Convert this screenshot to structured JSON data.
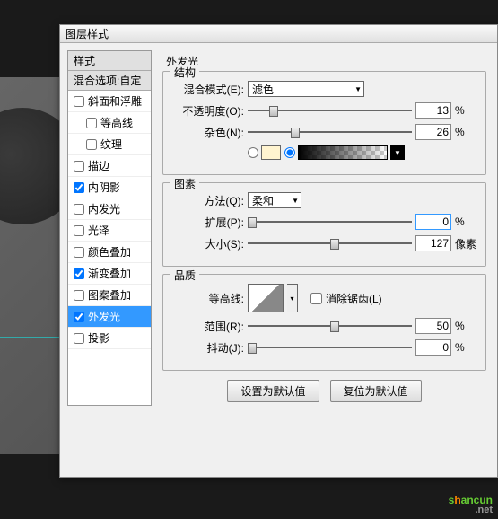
{
  "dialog": {
    "title": "图层样式"
  },
  "sidebar": {
    "header": "样式",
    "blend_header": "混合选项:自定",
    "items": [
      {
        "label": "斜面和浮雕",
        "checked": false,
        "indent": false
      },
      {
        "label": "等高线",
        "checked": false,
        "indent": true
      },
      {
        "label": "纹理",
        "checked": false,
        "indent": true
      },
      {
        "label": "描边",
        "checked": false,
        "indent": false
      },
      {
        "label": "内阴影",
        "checked": true,
        "indent": false
      },
      {
        "label": "内发光",
        "checked": false,
        "indent": false
      },
      {
        "label": "光泽",
        "checked": false,
        "indent": false
      },
      {
        "label": "颜色叠加",
        "checked": false,
        "indent": false
      },
      {
        "label": "渐变叠加",
        "checked": true,
        "indent": false
      },
      {
        "label": "图案叠加",
        "checked": false,
        "indent": false
      },
      {
        "label": "外发光",
        "checked": true,
        "indent": false,
        "selected": true
      },
      {
        "label": "投影",
        "checked": false,
        "indent": false
      }
    ]
  },
  "panel": {
    "title": "外发光",
    "struct": {
      "label": "结构",
      "blend_mode_label": "混合模式(E):",
      "blend_mode_value": "滤色",
      "opacity_label": "不透明度(O):",
      "opacity_value": "13",
      "opacity_unit": "%",
      "noise_label": "杂色(N):",
      "noise_value": "26",
      "noise_unit": "%"
    },
    "element": {
      "label": "图素",
      "method_label": "方法(Q):",
      "method_value": "柔和",
      "spread_label": "扩展(P):",
      "spread_value": "0",
      "spread_unit": "%",
      "size_label": "大小(S):",
      "size_value": "127",
      "size_unit": "像素"
    },
    "quality": {
      "label": "品质",
      "contour_label": "等高线:",
      "antialias_label": "消除锯齿(L)",
      "range_label": "范围(R):",
      "range_value": "50",
      "range_unit": "%",
      "jitter_label": "抖动(J):",
      "jitter_value": "0",
      "jitter_unit": "%"
    },
    "buttons": {
      "default": "设置为默认值",
      "reset": "复位为默认值"
    }
  },
  "watermark": {
    "text": "shancun",
    "net": ".net"
  }
}
